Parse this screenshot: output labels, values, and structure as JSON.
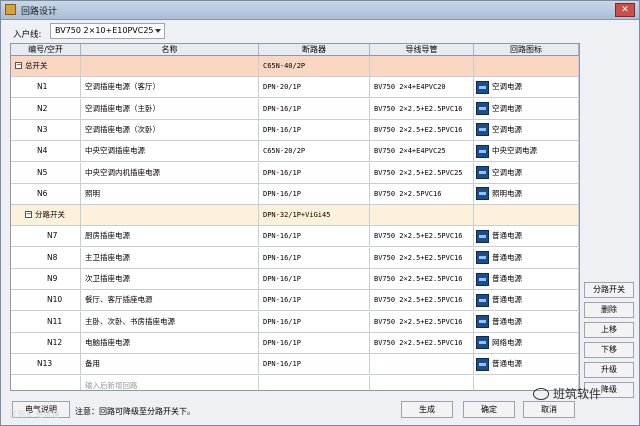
{
  "window": {
    "title": "回路设计"
  },
  "inline_line": {
    "label": "入户线:",
    "value": "BV750 2×10+E10PVC25"
  },
  "columns": [
    "编号/空开",
    "名称",
    "断路器",
    "导线导管",
    "回路图标"
  ],
  "groups": [
    {
      "id": "总开关",
      "name": "",
      "breaker": "C65N-40/2P",
      "wire": "",
      "icon": "",
      "rows": [
        {
          "id": "N1",
          "name": "空调插座电源（客厅）",
          "breaker": "DPN-20/1P",
          "wire": "BV750 2×4+E4PVC20",
          "icon": "空调电源"
        },
        {
          "id": "N2",
          "name": "空调插座电源（主卧）",
          "breaker": "DPN-16/1P",
          "wire": "BV750 2×2.5+E2.5PVC16",
          "icon": "空调电源"
        },
        {
          "id": "N3",
          "name": "空调插座电源（次卧）",
          "breaker": "DPN-16/1P",
          "wire": "BV750 2×2.5+E2.5PVC16",
          "icon": "空调电源"
        },
        {
          "id": "N4",
          "name": "中央空调插座电源",
          "breaker": "C65N-20/2P",
          "wire": "BV750 2×4+E4PVC25",
          "icon": "中央空调电源"
        },
        {
          "id": "N5",
          "name": "中央空调内机插座电源",
          "breaker": "DPN-16/1P",
          "wire": "BV750 2×2.5+E2.5PVC25",
          "icon": "空调电源"
        },
        {
          "id": "N6",
          "name": "照明",
          "breaker": "DPN-16/1P",
          "wire": "BV750 2×2.5PVC16",
          "icon": "照明电源"
        }
      ]
    },
    {
      "id": "分路开关",
      "name": "",
      "breaker": "DPN-32/1P+ViGi45",
      "wire": "",
      "icon": "",
      "rows": [
        {
          "id": "N7",
          "name": "厨房插座电源",
          "breaker": "DPN-16/1P",
          "wire": "BV750 2×2.5+E2.5PVC16",
          "icon": "普通电源"
        },
        {
          "id": "N8",
          "name": "主卫插座电源",
          "breaker": "DPN-16/1P",
          "wire": "BV750 2×2.5+E2.5PVC16",
          "icon": "普通电源"
        },
        {
          "id": "N9",
          "name": "次卫插座电源",
          "breaker": "DPN-16/1P",
          "wire": "BV750 2×2.5+E2.5PVC16",
          "icon": "普通电源"
        },
        {
          "id": "N10",
          "name": "餐厅、客厅插座电源",
          "breaker": "DPN-16/1P",
          "wire": "BV750 2×2.5+E2.5PVC16",
          "icon": "普通电源"
        },
        {
          "id": "N11",
          "name": "主卧、次卧、书房插座电源",
          "breaker": "DPN-16/1P",
          "wire": "BV750 2×2.5+E2.5PVC16",
          "icon": "普通电源"
        },
        {
          "id": "N12",
          "name": "电脑插座电源",
          "breaker": "DPN-16/1P",
          "wire": "BV750 2×2.5+E2.5PVC16",
          "icon": "网络电源"
        }
      ]
    }
  ],
  "trailing": [
    {
      "id": "N13",
      "name": "备用",
      "breaker": "DPN-16/1P",
      "wire": "",
      "icon": "普通电源"
    }
  ],
  "new_row_placeholder": "输入后新增回路",
  "side_buttons": [
    "分路开关",
    "删除",
    "上移",
    "下移",
    "升级",
    "降级"
  ],
  "footer": {
    "help_button": "电气说明",
    "note": "注意：回路可降级至分路开关下。",
    "generate_button": "生成",
    "ok_button": "确定",
    "cancel_button": "取消"
  },
  "watermark": "班筑软件",
  "watermark_left": "江苏大 班筑建",
  "colors": {
    "total_row": "#fad7c2",
    "branch_row": "#fdf1dc",
    "icon_blue": "#1e4d86"
  }
}
